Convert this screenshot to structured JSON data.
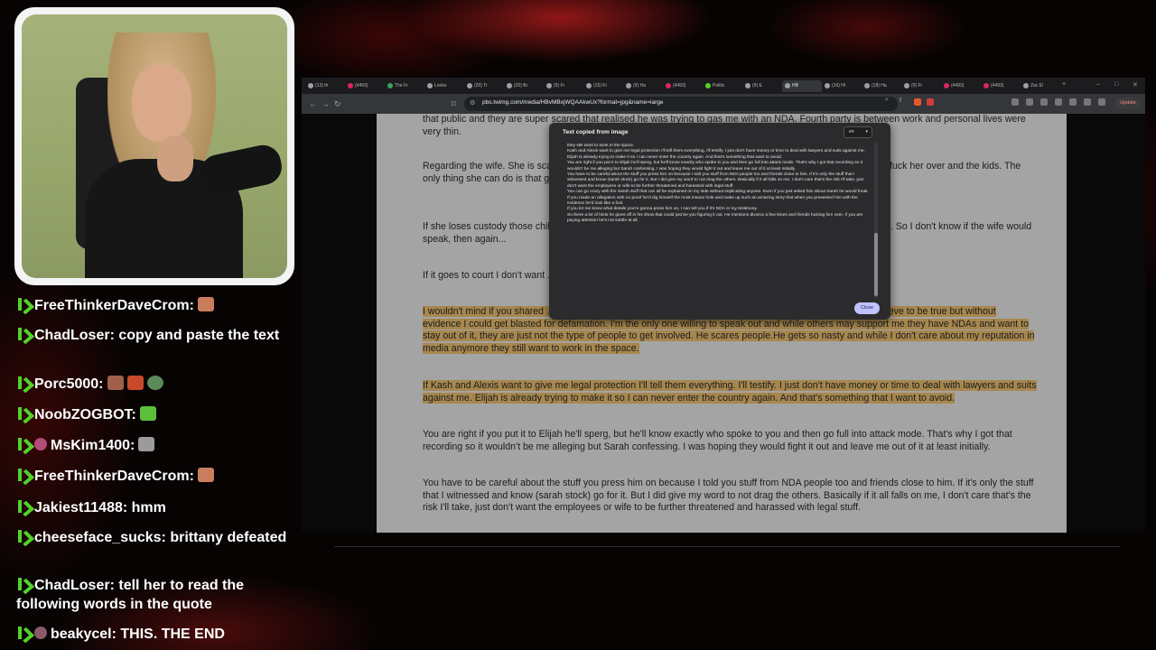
{
  "chat": {
    "messages": [
      {
        "user": "FreeThinkerDaveCrom:",
        "text": "",
        "emote_colors": [
          "#c97d5d"
        ],
        "avatar": false
      },
      {
        "user": "ChadLoser:",
        "text": "copy and paste the text",
        "emote_colors": [],
        "avatar": false
      },
      {
        "user": "Porc5000:",
        "text": "",
        "emote_colors": [
          "#a0604a",
          "#c94a2a",
          "#5d8a5a"
        ],
        "avatar": false
      },
      {
        "user": "NoobZOGBOT:",
        "text": "",
        "emote_colors": [
          "#5cbf3a"
        ],
        "avatar": false
      },
      {
        "user": "MsKim1400:",
        "text": "",
        "emote_colors": [
          "#9b9b9b"
        ],
        "avatar": true
      },
      {
        "user": "FreeThinkerDaveCrom:",
        "text": "",
        "emote_colors": [
          "#c97d5d"
        ],
        "avatar": false
      },
      {
        "user": "Jakiest11488:",
        "text": "hmm",
        "emote_colors": [],
        "avatar": false
      },
      {
        "user": "cheeseface_sucks:",
        "text": "brittany defeated",
        "emote_colors": [],
        "avatar": false
      },
      {
        "user": "ChadLoser:",
        "text": "tell her to read the following words in the quote",
        "emote_colors": [],
        "avatar": false
      },
      {
        "user": "beakycel:",
        "text": "THIS. THE END",
        "emote_colors": [],
        "avatar": true
      }
    ]
  },
  "browser": {
    "tabs": [
      {
        "label": "(13) th",
        "color": "#9aa0a6"
      },
      {
        "label": "(4493)",
        "color": "#e0245e"
      },
      {
        "label": "The Fr",
        "color": "#3aa55d"
      },
      {
        "label": "Looks",
        "color": "#9aa0a6"
      },
      {
        "label": "(20) Tr",
        "color": "#9aa0a6"
      },
      {
        "label": "(20) Br",
        "color": "#9aa0a6"
      },
      {
        "label": "(9) Fr",
        "color": "#9aa0a6"
      },
      {
        "label": "(15) Ki",
        "color": "#9aa0a6"
      },
      {
        "label": "(9) Ha",
        "color": "#9aa0a6"
      },
      {
        "label": "(4493)",
        "color": "#e0245e"
      },
      {
        "label": "Politic",
        "color": "#53d22a"
      },
      {
        "label": "(9) E",
        "color": "#9aa0a6"
      },
      {
        "label": "HB",
        "color": "#9aa0a6"
      },
      {
        "label": "(16) Hi",
        "color": "#9aa0a6"
      },
      {
        "label": "(18) Ha",
        "color": "#9aa0a6"
      },
      {
        "label": "(9) Fi",
        "color": "#9aa0a6"
      },
      {
        "label": "(4493)",
        "color": "#e0245e"
      },
      {
        "label": "(4493)",
        "color": "#e0245e"
      },
      {
        "label": "Zac E!",
        "color": "#9aa0a6"
      }
    ],
    "active_tab_index": 12,
    "url": "pbs.twimg.com/media/HBvMBxjWQAAkwUx?format=jpg&name=large",
    "update_label": "Update"
  },
  "document": {
    "paragraphs": [
      {
        "text": "that public and they are super scared that realised he was trying to gas me with an NDA. Fourth party is between work and personal lives were very thin.",
        "highlight": false
      },
      {
        "text": "Regarding the wife. She is scared of anything that comes out. He will try to sue me for sure and then will go to fuck her over and the kids. The only thing she can do is that guy with the kids. So we can't let that happen. I'm...",
        "highlight": false
      },
      {
        "text": "If she loses custody those children will have nothing. I don't want it to be about that right now. He ... complaints. So I don't know if the wife would speak, then again...",
        "highlight": false
      },
      {
        "text": "If it goes to court I don't want ... behalf of the wife. I'm doing this because Elijah is evil and it's...",
        "highlight": false
      },
      {
        "text": "I wouldn't mind if you shared ... everything I say put under a microscope. Not that I tell you anything I don't believe to be true but without evidence I could get blasted for defamation. I'm the only one willing to speak out and while others may support me they have NDAs and want to stay out of it, they are just not the type of people to get involved. He scares people.He gets so nasty and while I don't care about my reputation in media anymore they still want to work in the space.",
        "highlight": true
      },
      {
        "text": "If Kash and Alexis want to give me legal protection I'll tell them everything. I'll testify. I just don't have money or time to deal with lawyers and suits against me. Elijah is already trying to make it so I can never enter the country again. And that's something that I want to avoid.",
        "highlight": true
      },
      {
        "text": "You are right if you put it to Elijah he'll sperg, but he'll know exactly who spoke to you and then go full into attack mode. That's why I got that recording so it wouldn't be me alleging but Sarah confessing. I was hoping they would fight it out and leave me out of it at least initially.",
        "highlight": false
      },
      {
        "text": "You have to be careful about the stuff you press him on because I told you stuff from NDA people too and friends close to him. If it's only the stuff that I witnessed and know (sarah stock) go for it. But I did give my word to not drag the others. Basically if it all falls on me, I don't care that's the risk I'll take, just don't want the employees or wife to be further threatened and harassed with legal stuff.",
        "highlight": false
      }
    ]
  },
  "popup": {
    "title": "Text copied from image",
    "language": "en",
    "close_label": "Close",
    "lines": [
      "they still want to work in the space.",
      "Kash and Alexis want to give me legal protection I'll tell them everything. I'll testify. I just don't have money or time to deal with lawyers and suits against me. Elijah is already trying to make it so I can never enter the country again. And that's something that want to avoid.",
      "You are right if you put it to Elijah he'll sperg, but he'll know exactly who spoke to you and then go full into attack mode. That's why I got that recording so it wouldn't be me alleging but Sarah confessing. I was hoping they would fight it out and leave me out of it at least initially.",
      "You have to be careful about the stuff you press him on because I told you stuff from NDA people too and friends close to him. If it's only the stuff that I witnessed and know (sarah stock) go for it. But I did give my word to not drag the others. Basically if it all falls on me, I don't care that's the risk I'll take, just don't want the employees or wife to be further threatened and harassed with legal stuff.",
      "You can go crazy with the Sarah stuff that can all be explained on my side without implicating anyone. Even if you just asked him about Sarah he would freak.",
      "If you made an allegation with no proof he'd dig himself the most insane hole and make up such an amazing story that when you presented him with the evidence he'd look like a fool.",
      "If you let me know what details you're gonna press him on, I can tell you if it's NDA or my testimony.",
      "So there a lot of hints he gives off in his show that could just be you figuring it out. He mentions divorce a few times and friends fucking him over. If you are paying attention he's not subtle at all."
    ]
  }
}
